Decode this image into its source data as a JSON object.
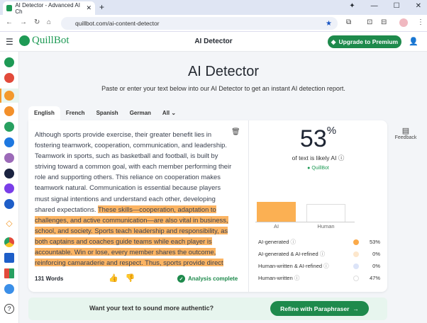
{
  "browser": {
    "tab_title": "AI Detector - Advanced AI Ch",
    "url": "quillbot.com/ai-content-detector"
  },
  "header": {
    "brand": "QuillBot",
    "title": "AI Detector",
    "premium": "Upgrade to Premium"
  },
  "page": {
    "title": "AI Detector",
    "subtitle": "Paste or enter your text below into our AI Detector to get an instant AI detection report."
  },
  "languages": [
    "English",
    "French",
    "Spanish",
    "German",
    "All"
  ],
  "editor": {
    "plain": "Although sports provide exercise, their greater benefit lies in fostering teamwork, cooperation, communication, and leadership. Teamwork in sports, such as basketball and football, is built by striving toward a common goal, with each member performing their role and supporting others. This reliance on cooperation makes teamwork natural. Communication is essential because players must signal intentions and understand each other, developing shared expectations. ",
    "highlighted": "These skills—cooperation, adaptation to challenges, and active communication—are also vital in business, school, and society. Sports teach leadership and responsibility, as both captains and coaches guide teams while each player is accountable. Win or lose, every member shares the outcome, reinforcing camaraderie and respect. Thus, sports provide direct",
    "word_count": "131 Words",
    "status": "Analysis complete"
  },
  "result": {
    "percent": "53",
    "percent_sign": "%",
    "caption": "of text is likely AI",
    "brand": "QuillBot",
    "bars": [
      {
        "label": "AI",
        "value": 53,
        "color": "#fbb053"
      },
      {
        "label": "Human",
        "value": 47,
        "color": "#ffffff"
      }
    ],
    "legend": [
      {
        "label": "AI-generated",
        "value": "53%",
        "color": "#fbaa4a"
      },
      {
        "label": "AI-generated & AI-refined",
        "value": "0%",
        "color": "#fde7cc"
      },
      {
        "label": "Human-written & AI-refined",
        "value": "0%",
        "color": "#dce4f8"
      },
      {
        "label": "Human-written",
        "value": "47%",
        "color": "#ffffff"
      }
    ]
  },
  "banner": {
    "text": "Want your text to sound more authentic?",
    "button": "Refine with Paraphraser"
  },
  "feedback": "Feedback"
}
